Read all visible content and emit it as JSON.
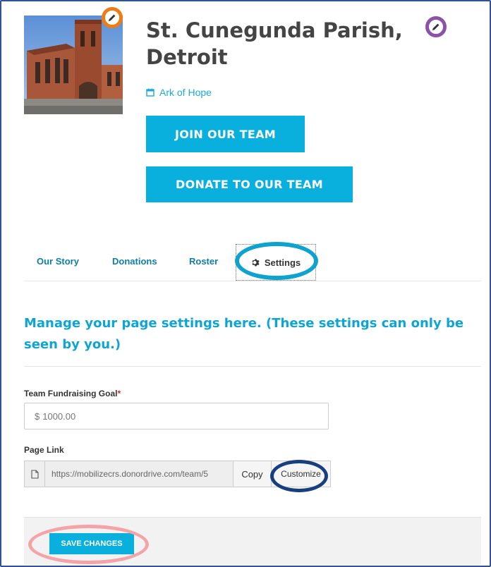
{
  "header": {
    "title": "St. Cunegunda Parish, Detroit",
    "event_name": "Ark of Hope",
    "join_label": "JOIN OUR TEAM",
    "donate_label": "DONATE TO OUR TEAM"
  },
  "tabs": [
    {
      "label": "Our Story"
    },
    {
      "label": "Donations"
    },
    {
      "label": "Roster"
    },
    {
      "label": "Settings",
      "active": true
    }
  ],
  "settings": {
    "heading": "Manage your page settings here. (These settings can only be seen by you.)",
    "goal_label": "Team Fundraising Goal",
    "goal_required_mark": "*",
    "goal_currency": "$",
    "goal_value": "1000.00",
    "link_label": "Page Link",
    "link_url": "https://mobilizecrs.donordrive.com/team/5",
    "copy_label": "Copy",
    "customize_label": "Customize",
    "save_label": "SAVE CHANGES"
  },
  "colors": {
    "accent": "#09b0dd",
    "title_text": "#444444",
    "tab_text": "#0f7da8",
    "annotation_orange": "#ee7d16",
    "annotation_purple": "#8c52a8",
    "annotation_cyan": "#0ea2cf",
    "annotation_navy": "#173e7e",
    "annotation_pink": "#f4a3a8"
  },
  "icons": {
    "photo_edit": "pencil-icon",
    "title_edit": "pencil-icon",
    "event": "calendar-icon",
    "settings_tab": "gear-icon",
    "page_link": "document-icon"
  }
}
